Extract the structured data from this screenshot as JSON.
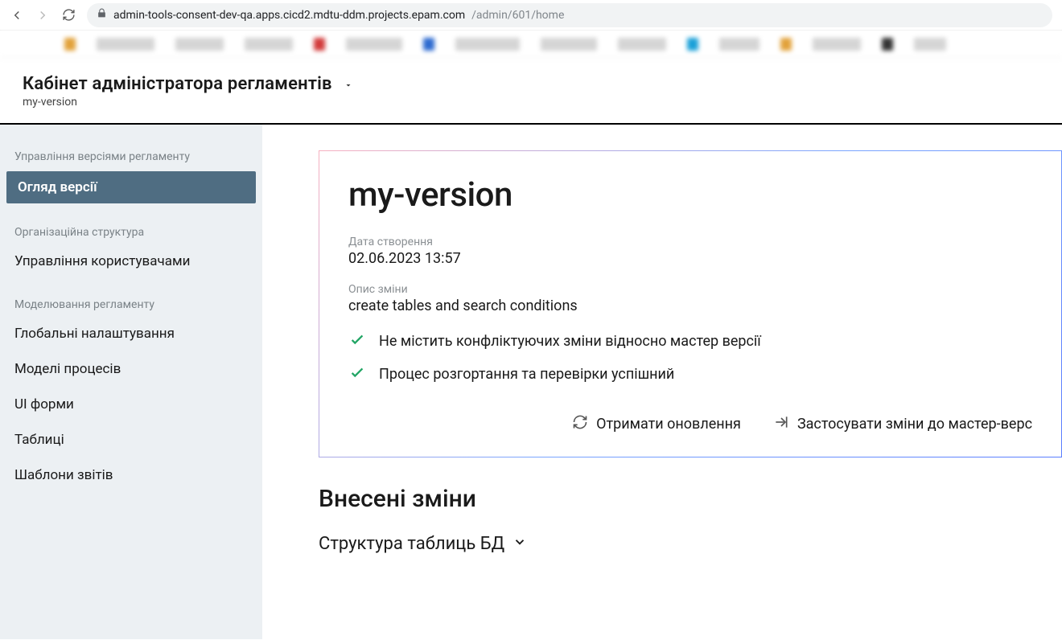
{
  "browser": {
    "url_host": "admin-tools-consent-dev-qa.apps.cicd2.mdtu-ddm.projects.epam.com",
    "url_path": "/admin/601/home"
  },
  "header": {
    "title": "Кабінет адміністратора регламентів",
    "subtitle": "my-version"
  },
  "sidebar": {
    "group1_label": "Управління версіями регламенту",
    "item_overview": "Огляд версії",
    "group2_label": "Організаційна структура",
    "item_users": "Управління користувачами",
    "group3_label": "Моделювання регламенту",
    "item_global": "Глобальні налаштування",
    "item_processes": "Моделі процесів",
    "item_forms": "UI форми",
    "item_tables": "Таблиці",
    "item_reports": "Шаблони звітів"
  },
  "card": {
    "title": "my-version",
    "created_label": "Дата створення",
    "created_value": "02.06.2023 13:57",
    "desc_label": "Опис зміни",
    "desc_value": "create tables and search conditions",
    "status_conflict": "Не містить конфліктуючих зміни відносно мастер версії",
    "status_deploy": "Процес розгортання та перевірки успішний",
    "action_refresh": "Отримати оновлення",
    "action_apply": "Застосувати зміни до мастер-верс"
  },
  "changes": {
    "heading": "Внесені зміни",
    "expander_db": "Структура таблиць БД"
  }
}
